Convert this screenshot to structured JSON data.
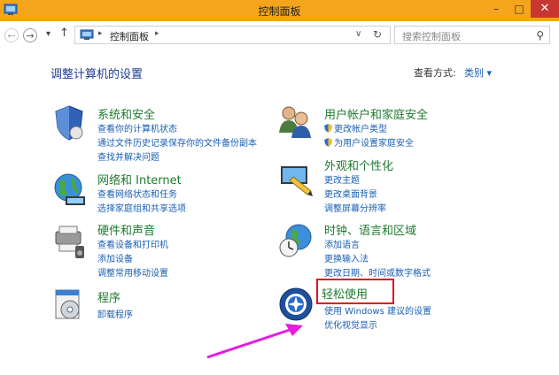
{
  "window": {
    "title": "控制面板"
  },
  "titlebar": {
    "minimize": "–",
    "maximize": "□",
    "close": "✕"
  },
  "nav": {
    "back_icon": "back-arrow-icon",
    "forward_icon": "forward-arrow-icon",
    "up_icon": "up-arrow-icon",
    "breadcrumb": "控制面板",
    "search_placeholder": "搜索控制面板"
  },
  "main": {
    "heading": "调整计算机的设置",
    "view_by_label": "查看方式:",
    "view_by_value": "类别 ▾"
  },
  "categories": [
    {
      "title": "系统和安全",
      "icon": "system-security-icon",
      "links": [
        "查看你的计算机状态",
        "通过文件历史记录保存你的文件备份副本",
        "查找并解决问题"
      ]
    },
    {
      "title": "网络和 Internet",
      "icon": "network-icon",
      "links": [
        "查看网络状态和任务",
        "选择家庭组和共享选项"
      ]
    },
    {
      "title": "硬件和声音",
      "icon": "hardware-sound-icon",
      "links": [
        "查看设备和打印机",
        "添加设备",
        "调整常用移动设置"
      ]
    },
    {
      "title": "程序",
      "icon": "programs-icon",
      "links": [
        "卸载程序"
      ]
    },
    {
      "title": "用户帐户和家庭安全",
      "icon": "user-accounts-icon",
      "links": [
        "更改帐户类型",
        "为用户设置家庭安全"
      ]
    },
    {
      "title": "外观和个性化",
      "icon": "appearance-icon",
      "links": [
        "更改主题",
        "更改桌面背景",
        "调整屏幕分辨率"
      ]
    },
    {
      "title": "时钟、语言和区域",
      "icon": "clock-region-icon",
      "links": [
        "添加语言",
        "更换输入法",
        "更改日期、时间或数字格式"
      ]
    },
    {
      "title": "轻松使用",
      "icon": "ease-of-access-icon",
      "links": [
        "使用 Windows 建议的设置",
        "优化视觉显示"
      ]
    }
  ],
  "colors": {
    "titlebar": "#f5a51b",
    "close": "#c7372f",
    "link": "#1a5fb4",
    "category": "#1e7b2e",
    "highlight": "#e2111a",
    "arrow": "#e41de0"
  }
}
